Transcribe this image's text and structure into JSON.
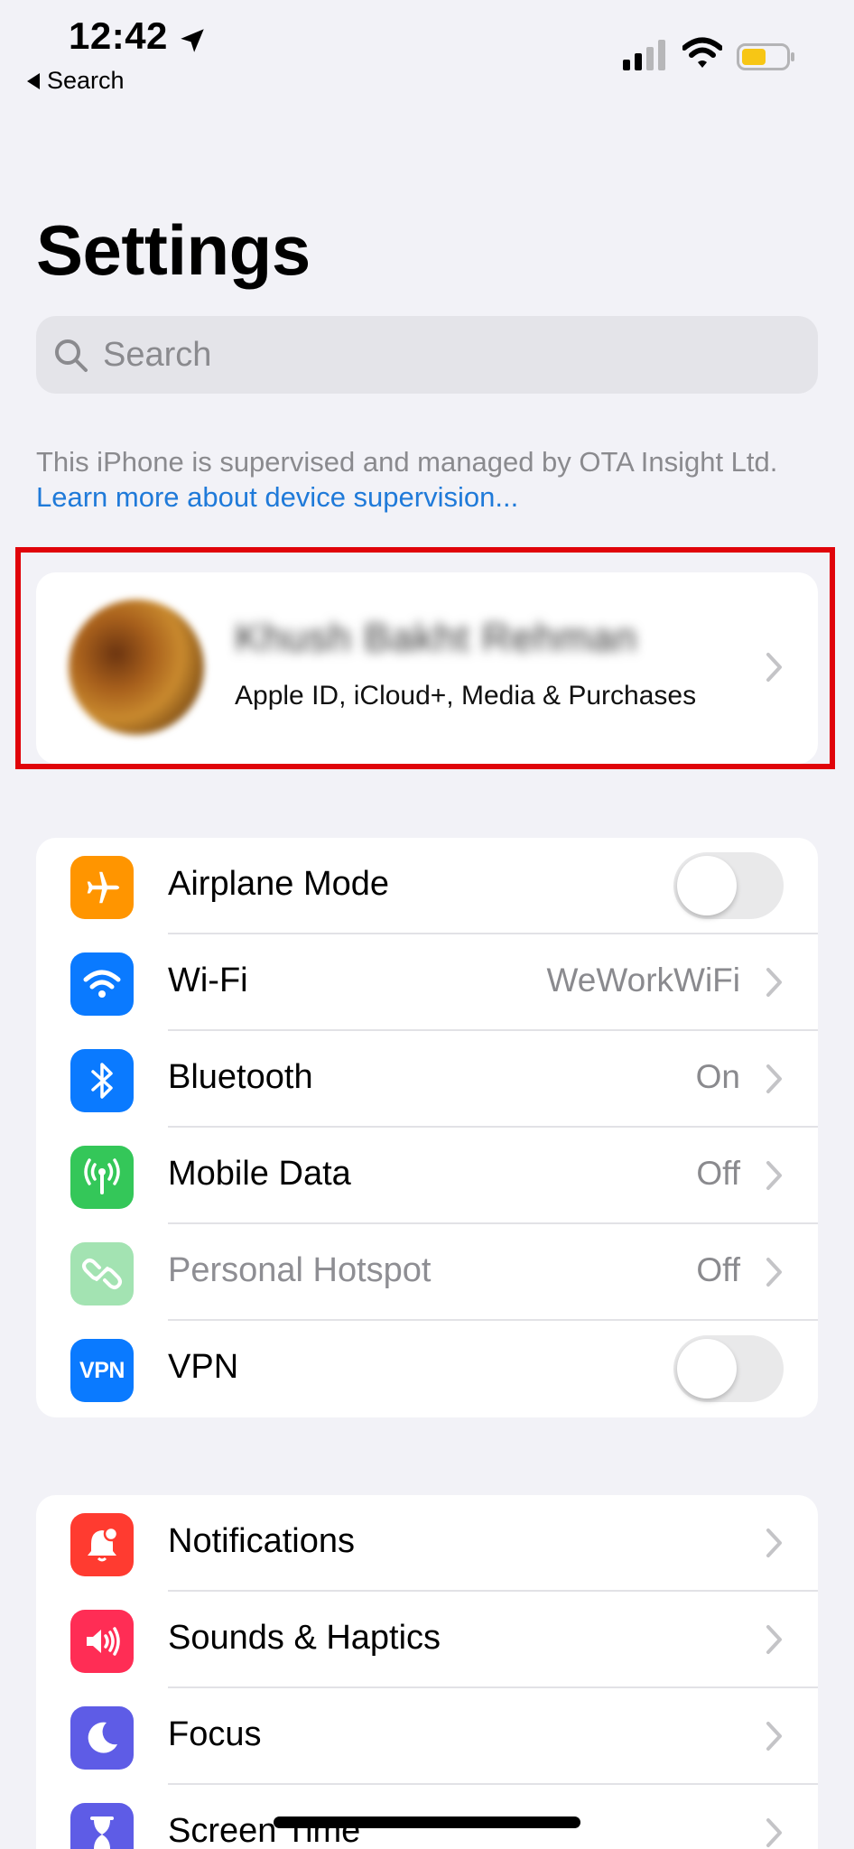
{
  "status_bar": {
    "time": "12:42",
    "back_label": "Search",
    "battery_color": "#f7c615"
  },
  "header": {
    "title": "Settings"
  },
  "search": {
    "placeholder": "Search"
  },
  "supervision": {
    "text": "This iPhone is supervised and managed by OTA Insight Ltd.",
    "link": "Learn more about device supervision..."
  },
  "profile": {
    "name": "Khush Bakht Rehman",
    "subtitle": "Apple ID, iCloud+, Media & Purchases"
  },
  "connectivity": [
    {
      "label": "Airplane Mode",
      "icon": "airplane-icon",
      "color": "#ff9500",
      "type": "toggle",
      "on": false
    },
    {
      "label": "Wi-Fi",
      "icon": "wifi-icon",
      "color": "#0a7aff",
      "value": "WeWorkWiFi"
    },
    {
      "label": "Bluetooth",
      "icon": "bluetooth-icon",
      "color": "#0a7aff",
      "value": "On"
    },
    {
      "label": "Mobile Data",
      "icon": "antenna-icon",
      "color": "#34c759",
      "value": "Off"
    },
    {
      "label": "Personal Hotspot",
      "icon": "hotspot-icon",
      "color": "#a3e3b2",
      "value": "Off",
      "dimmed": true
    },
    {
      "label": "VPN",
      "icon": "vpn-icon",
      "icon_text": "VPN",
      "color": "#0a7aff",
      "type": "toggle",
      "on": false
    }
  ],
  "general": [
    {
      "label": "Notifications",
      "icon": "bell-icon",
      "color": "#ff3b30"
    },
    {
      "label": "Sounds & Haptics",
      "icon": "speaker-icon",
      "color": "#ff2d55"
    },
    {
      "label": "Focus",
      "icon": "moon-icon",
      "color": "#5e5ce6"
    },
    {
      "label": "Screen Time",
      "icon": "hourglass-icon",
      "color": "#5e5ce6"
    }
  ]
}
